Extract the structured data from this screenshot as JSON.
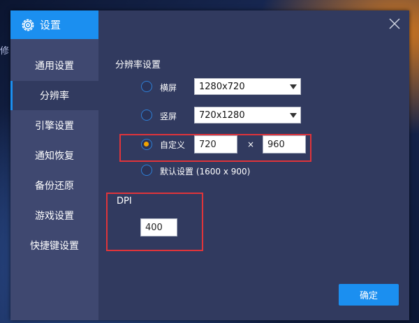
{
  "background": {
    "partial_text": "修"
  },
  "dialog": {
    "title": "设置",
    "sidebar": {
      "items": [
        {
          "label": "通用设置",
          "active": false
        },
        {
          "label": "分辨率",
          "active": true
        },
        {
          "label": "引擎设置",
          "active": false
        },
        {
          "label": "通知恢复",
          "active": false
        },
        {
          "label": "备份还原",
          "active": false
        },
        {
          "label": "游戏设置",
          "active": false
        },
        {
          "label": "快捷键设置",
          "active": false
        }
      ]
    },
    "resolution": {
      "section_title": "分辨率设置",
      "landscape": {
        "label": "横屏",
        "value": "1280x720",
        "selected": false
      },
      "portrait": {
        "label": "竖屏",
        "value": "720x1280",
        "selected": false
      },
      "custom": {
        "label": "自定义",
        "width": "720",
        "separator": "×",
        "height": "960",
        "selected": true
      },
      "default": {
        "label": "默认设置 (1600 x 900)",
        "selected": false
      }
    },
    "dpi": {
      "title": "DPI",
      "value": "400"
    },
    "confirm_label": "确定"
  },
  "colors": {
    "accent": "#1b8ff0",
    "radio_selected": "#f0a400",
    "highlight_box": "#e0343a",
    "panel": "#313a5f",
    "sidebar": "#3f4870"
  }
}
